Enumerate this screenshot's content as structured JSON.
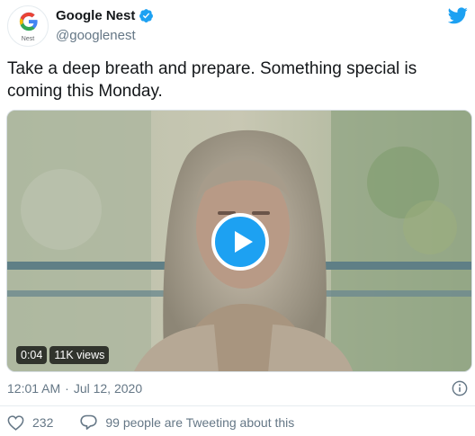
{
  "author": {
    "name": "Google Nest",
    "handle": "@googlenest",
    "avatar_caption": "Nest",
    "verified": true
  },
  "tweet": {
    "text": "Take a deep breath and prepare. Something special is\ncoming this Monday."
  },
  "video": {
    "duration": "0:04",
    "views": "11K views"
  },
  "meta": {
    "time": "12:01 AM",
    "separator": "·",
    "date": "Jul 12, 2020"
  },
  "actions": {
    "like_count": "232",
    "conversation": "99 people are Tweeting about this"
  },
  "colors": {
    "accent": "#1da1f2",
    "text_secondary": "#657786",
    "like_red": "#e0245e"
  },
  "icons": [
    "google-g-icon",
    "verified-badge-icon",
    "twitter-bird-icon",
    "play-icon",
    "info-icon",
    "heart-icon",
    "reply-bubble-icon"
  ]
}
